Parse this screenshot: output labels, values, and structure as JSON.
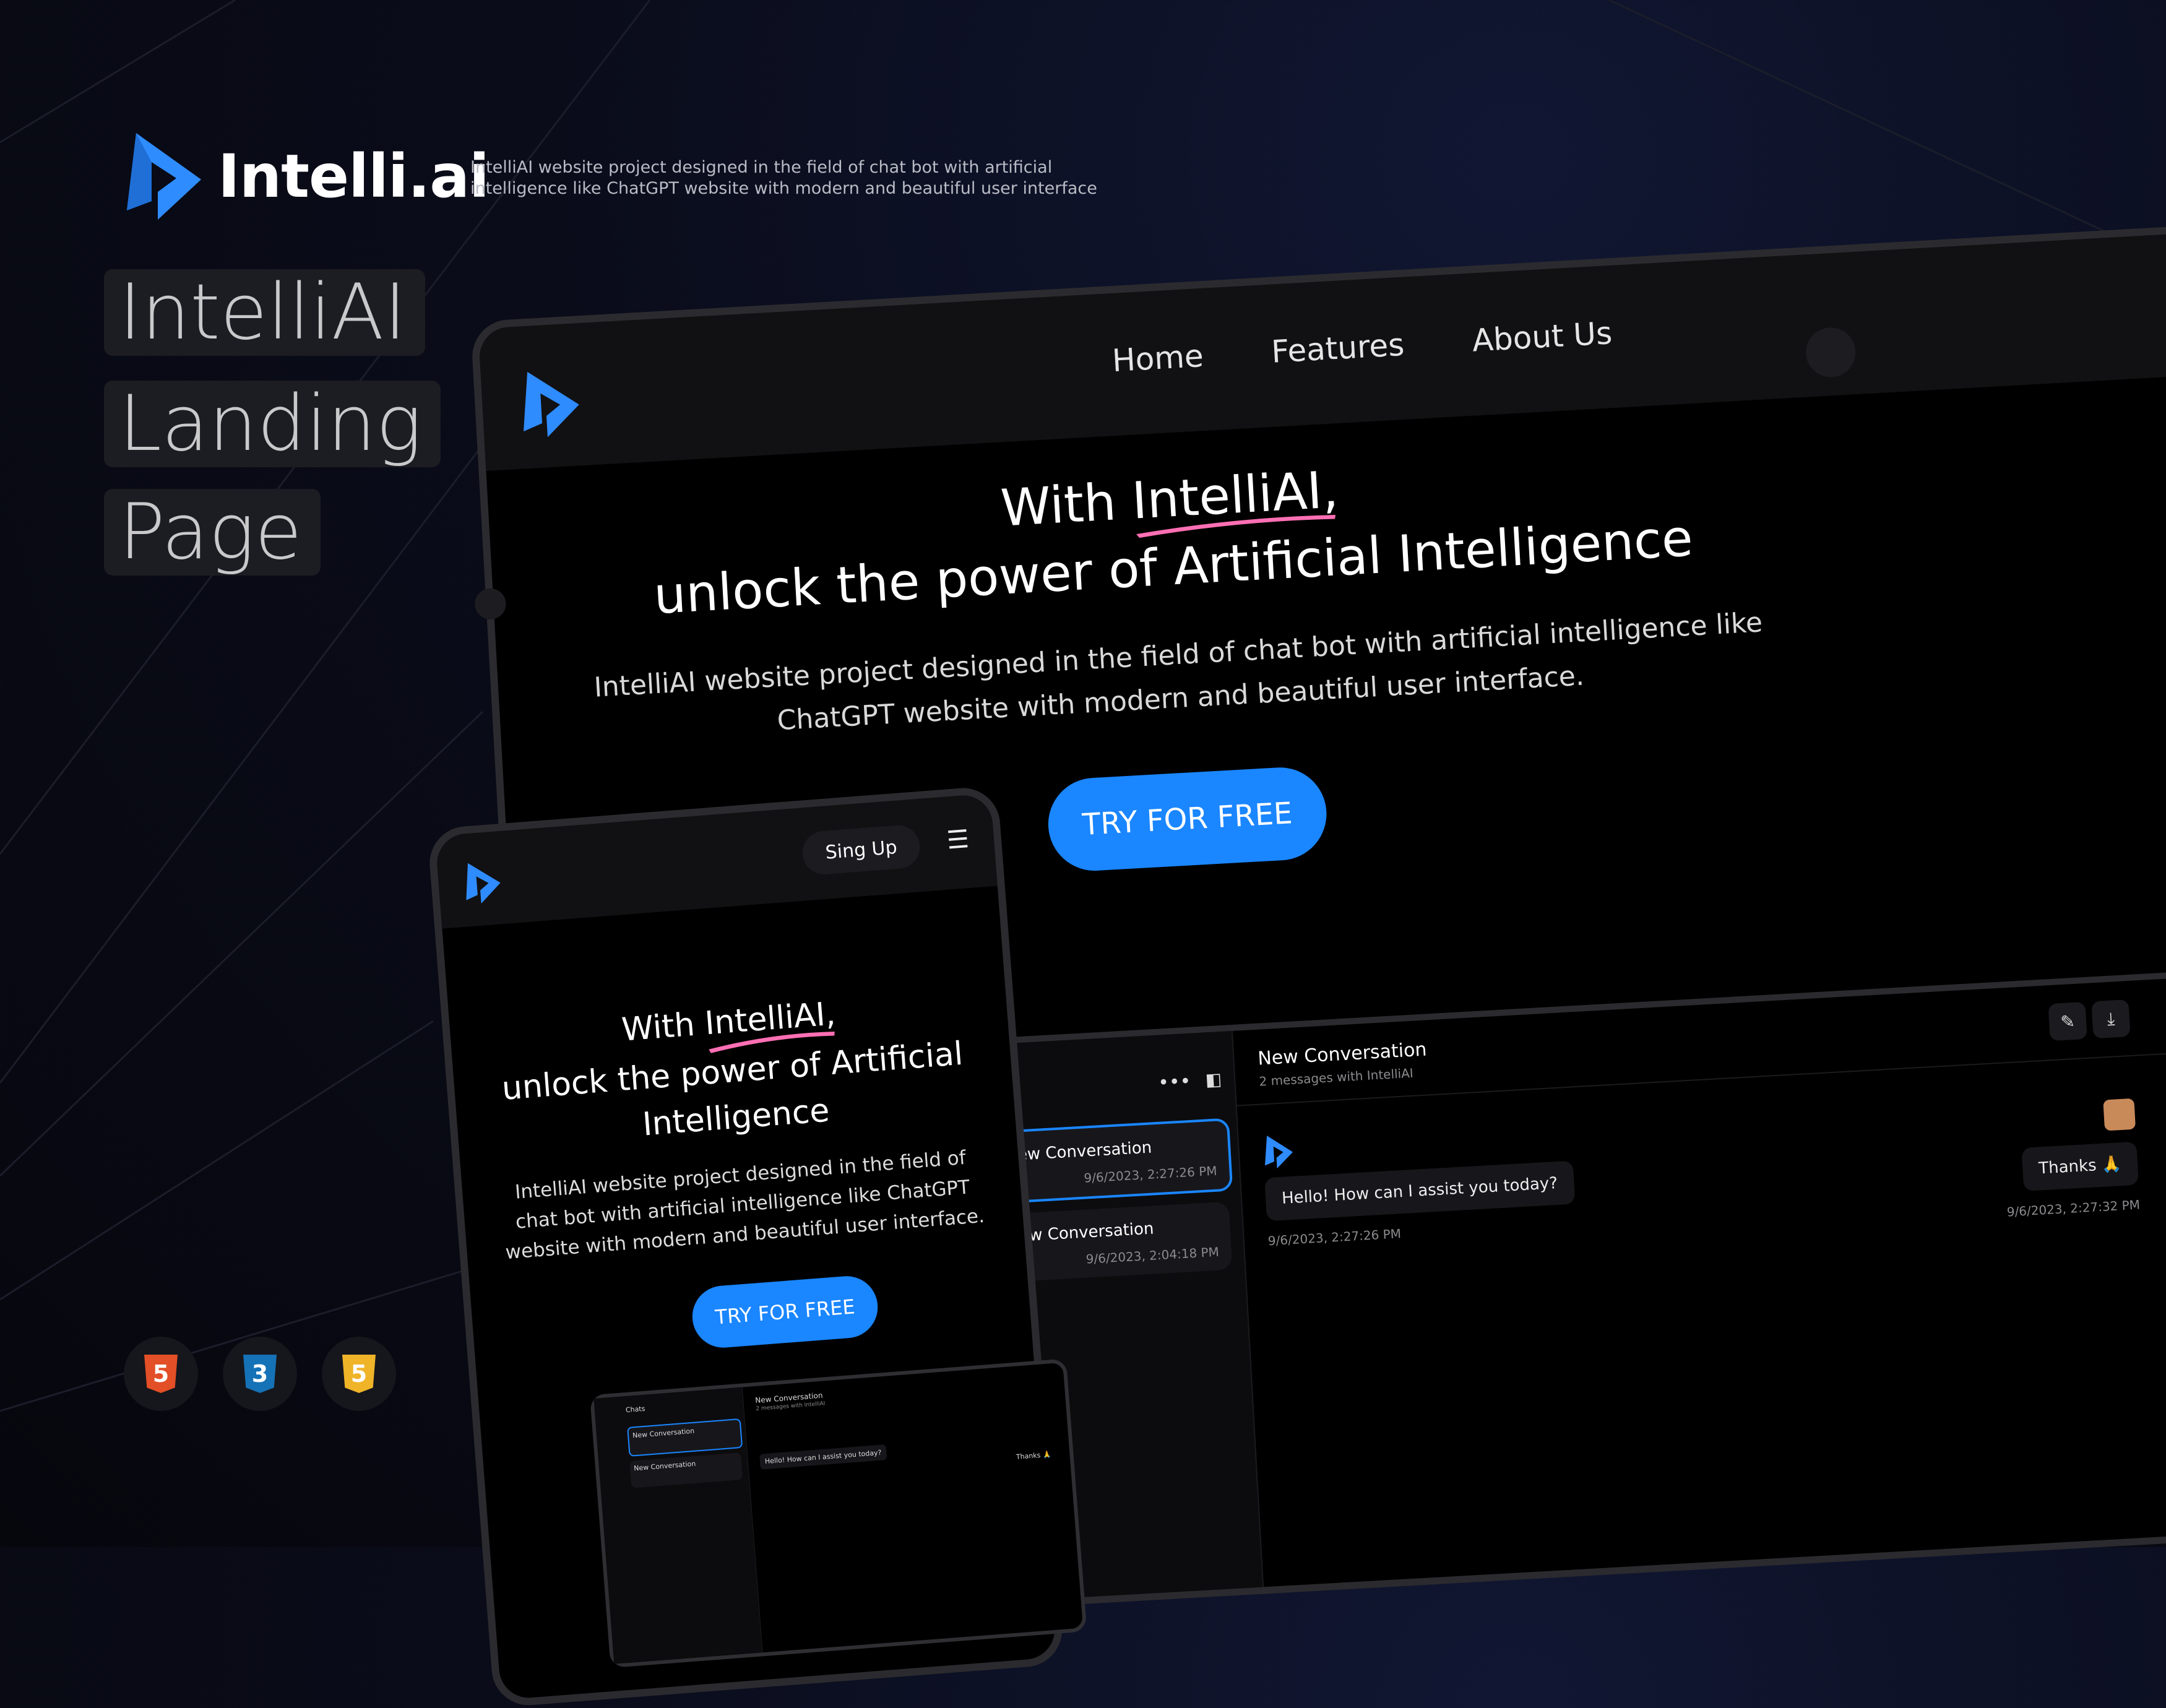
{
  "brand": {
    "name": "Intelli.ai",
    "description": "IntelliAI website project designed in the field of chat bot with artificial intelligence like ChatGPT website with modern and beautiful user interface",
    "accent": "#1a86ff",
    "highlight": "#ff6fb4"
  },
  "title_lines": [
    "IntelliAI",
    "Landing",
    "Page"
  ],
  "tech_icons": [
    {
      "name": "html5-icon",
      "label": "5",
      "color": "#e34f26"
    },
    {
      "name": "css3-icon",
      "label": "3",
      "color": "#1572b6"
    },
    {
      "name": "js-icon",
      "label": "5",
      "color": "#f0b429"
    }
  ],
  "desktop": {
    "nav": [
      "Home",
      "Features",
      "About Us"
    ],
    "hero_prefix": "With ",
    "hero_brand": "IntelliAI,",
    "hero_line2": "unlock the power of Artificial Intelligence",
    "subtitle": "IntelliAI website project designed in the field of chat bot with artificial intelligence like ChatGPT website with modern and beautiful user interface.",
    "cta": "TRY FOR FREE"
  },
  "chat": {
    "title": "New Conversation",
    "subtitle": "2 messages with IntelliAI",
    "conversations": [
      {
        "title": "New Conversation",
        "date": "9/6/2023, 2:27:26 PM"
      },
      {
        "title": "New Conversation",
        "date": "9/6/2023, 2:04:18 PM"
      }
    ],
    "bot_message": "Hello! How can I assist you today?",
    "bot_time": "9/6/2023, 2:27:26 PM",
    "user_message": "Thanks 🙏",
    "user_time": "9/6/2023, 2:27:32 PM"
  },
  "tablet": {
    "signup": "Sing Up",
    "menu_icon": "☰",
    "hero_prefix": "With ",
    "hero_brand": "IntelliAI,",
    "hero_line2": "unlock the power of Artificial",
    "hero_line3": "Intelligence",
    "subtitle": "IntelliAI website project designed in the field of chat bot with artificial intelligence like ChatGPT website with modern and beautiful user interface.",
    "cta": "TRY FOR FREE",
    "mini": {
      "chats_label": "Chats",
      "title": "New Conversation",
      "subtitle": "2 messages with IntelliAI",
      "conv1": "New Conversation",
      "conv2": "New Conversation",
      "bot": "Hello! How can I assist you today?",
      "user": "Thanks 🙏"
    }
  }
}
